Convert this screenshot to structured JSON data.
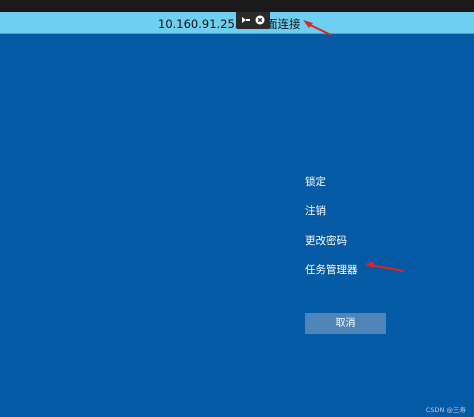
{
  "rdp_bar": {
    "host": "10.160.91.253 -",
    "title_suffix": "面连接",
    "pin_icon": "pin-icon",
    "close_icon": "close-circle-icon"
  },
  "menu": {
    "items": [
      "锁定",
      "注销",
      "更改密码",
      "任务管理器"
    ],
    "cancel_label": "取消"
  },
  "watermark": "CSDN @三寿",
  "colors": {
    "background": "#055aa6",
    "rdp_bar": "#6ecff0",
    "cancel_button": "#4f84b8",
    "annotation_arrow": "#e02424"
  }
}
